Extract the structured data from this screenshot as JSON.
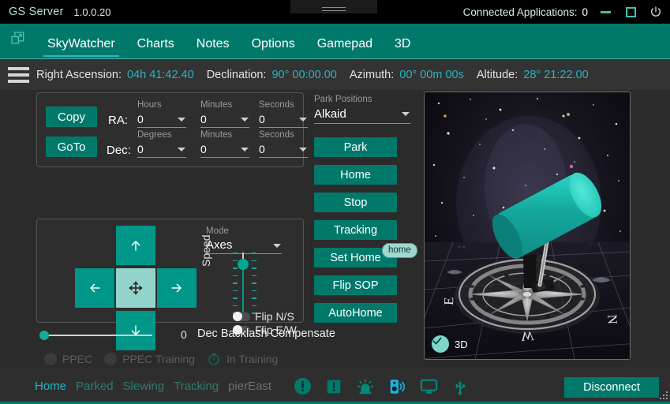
{
  "titlebar": {
    "app_name": "GS Server",
    "version": "1.0.0.20",
    "connected_label": "Connected Applications:",
    "connected_count": "0",
    "minimize_icon": "minimize-icon",
    "maximize_icon": "maximize-icon",
    "power_icon": "power-icon"
  },
  "nav": {
    "app_icon": "window-restore-icon",
    "tabs": [
      {
        "label": "SkyWatcher",
        "active": true
      },
      {
        "label": "Charts",
        "active": false
      },
      {
        "label": "Notes",
        "active": false
      },
      {
        "label": "Options",
        "active": false
      },
      {
        "label": "Gamepad",
        "active": false
      },
      {
        "label": "3D",
        "active": false
      }
    ]
  },
  "coordbar": {
    "menu_icon": "hamburger-menu-icon",
    "items": [
      {
        "label": "Right Ascension:",
        "value": "04h 41:42.40"
      },
      {
        "label": "Declination:",
        "value": "90° 00:00.00"
      },
      {
        "label": "Azimuth:",
        "value": "00° 00m 00s"
      },
      {
        "label": "Altitude:",
        "value": "28° 21:22.00"
      }
    ]
  },
  "radec_panel": {
    "copy_label": "Copy",
    "goto_label": "GoTo",
    "ra_label": "RA:",
    "dec_label": "Dec:",
    "ra_fields": [
      {
        "caption": "Hours",
        "value": "0"
      },
      {
        "caption": "Minutes",
        "value": "0"
      },
      {
        "caption": "Seconds",
        "value": "0"
      }
    ],
    "dec_fields": [
      {
        "caption": "Degrees",
        "value": "0"
      },
      {
        "caption": "Minutes",
        "value": "0"
      },
      {
        "caption": "Seconds",
        "value": "0"
      }
    ]
  },
  "move_panel": {
    "up_icon": "arrow-up-icon",
    "left_icon": "arrow-left-icon",
    "center_icon": "move-crosshair-icon",
    "right_icon": "arrow-right-icon",
    "down_icon": "arrow-down-icon",
    "mode_caption": "Mode",
    "mode_value": "Axes",
    "speed_label": "Speed",
    "speed_value": 8,
    "flip_ns_label": "Flip N/S",
    "flip_ew_label": "Flip E/W"
  },
  "backlash": {
    "value": "0",
    "label": "Dec Backlash Compensate",
    "slider_position": 0
  },
  "ppec": {
    "ppec_label": "PPEC",
    "ppec_training_label": "PPEC Training",
    "in_training_label": "In Training",
    "timer_icon": "timer-icon"
  },
  "park": {
    "caption": "Park Positions",
    "value": "Alkaid"
  },
  "actions": [
    {
      "label": "Park"
    },
    {
      "label": "Home"
    },
    {
      "label": "Stop"
    },
    {
      "label": "Tracking"
    },
    {
      "label": "Set Home"
    },
    {
      "label": "Flip SOP"
    },
    {
      "label": "AutoHome"
    }
  ],
  "tooltip": {
    "text": "home"
  },
  "view3d": {
    "badge_label": "3D",
    "badge_icon": "check-icon",
    "compass_labels": [
      "E",
      "N",
      "W"
    ]
  },
  "statusbar": {
    "words": [
      {
        "text": "Home",
        "state": "active"
      },
      {
        "text": "Parked",
        "state": "dim"
      },
      {
        "text": "Slewing",
        "state": "dim"
      },
      {
        "text": "Tracking",
        "state": "dim"
      },
      {
        "text": "pierEast",
        "state": "off"
      }
    ],
    "icons": [
      "alert-circle-icon",
      "alert-square-icon",
      "siren-icon",
      "speaker-icon",
      "monitor-icon",
      "usb-icon"
    ],
    "disconnect_label": "Disconnect",
    "resize_grip": "resize-grip-icon"
  },
  "colors": {
    "accent_teal": "#00796b",
    "bright_teal": "#009688",
    "cyan_text": "#2bb3c0",
    "panel_bg": "#2e2e2e",
    "window_bg": "#2b2b2b",
    "titlebar_bg": "#000000",
    "speaker_blue": "#16b5e8",
    "status_dim": "#2f7b72"
  }
}
